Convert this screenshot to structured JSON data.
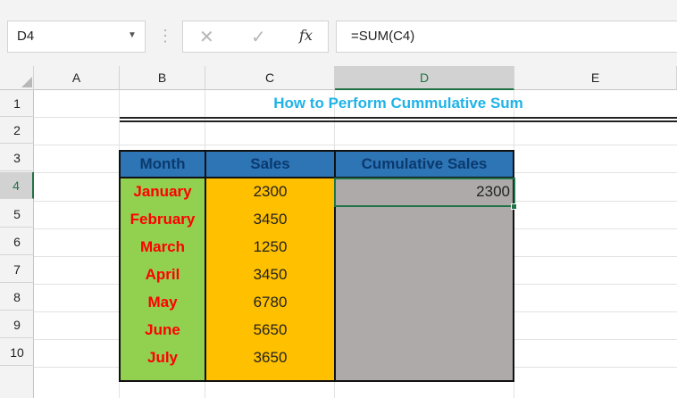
{
  "formula_bar": {
    "name_box": "D4",
    "fx_label": "fx",
    "formula": "=SUM(C4)"
  },
  "columns": [
    "A",
    "B",
    "C",
    "D",
    "E"
  ],
  "rows": [
    "1",
    "2",
    "3",
    "4",
    "5",
    "6",
    "7",
    "8",
    "9",
    "10"
  ],
  "sheet": {
    "title": "How to Perform Cummulative Sum",
    "headers": {
      "month": "Month",
      "sales": "Sales",
      "cumulative": "Cumulative Sales"
    },
    "records": [
      {
        "month": "January",
        "sales": "2300",
        "cumulative": "2300"
      },
      {
        "month": "February",
        "sales": "3450",
        "cumulative": ""
      },
      {
        "month": "March",
        "sales": "1250",
        "cumulative": ""
      },
      {
        "month": "April",
        "sales": "3450",
        "cumulative": ""
      },
      {
        "month": "May",
        "sales": "6780",
        "cumulative": ""
      },
      {
        "month": "June",
        "sales": "5650",
        "cumulative": ""
      },
      {
        "month": "July",
        "sales": "3650",
        "cumulative": ""
      }
    ]
  },
  "colors": {
    "title": "#1fb3e8",
    "header_fill": "#2e75b6",
    "month_fill": "#92d050",
    "month_text": "#ff0000",
    "sales_fill": "#ffc000",
    "cumulative_fill": "#aeaaaa",
    "selection": "#217346"
  }
}
